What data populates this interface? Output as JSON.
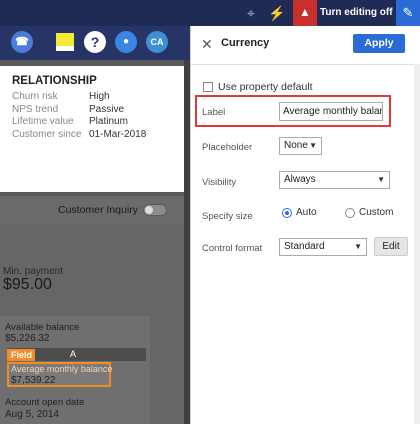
{
  "topbar": {
    "edit_off_label": "Turn editing off"
  },
  "icons": [
    "network-icon",
    "bolt-icon",
    "graduation-cap-icon",
    "pencil-icon",
    "phone-icon",
    "sticky-note-icon",
    "help-icon",
    "bot-icon"
  ],
  "appbar": {
    "avatar_initials": "CA",
    "help_glyph": "?"
  },
  "relationship": {
    "title": "RELATIONSHIP",
    "rows": [
      {
        "label": "Churn risk",
        "value": "High"
      },
      {
        "label": "NPS trend",
        "value": "Passive"
      },
      {
        "label": "Lifetime value",
        "value": "Platinum"
      },
      {
        "label": "Customer since",
        "value": "01-Mar-2018"
      }
    ]
  },
  "left": {
    "customer_inquiry": "Customer Inquiry",
    "min_payment_label": "Min. payment",
    "min_payment_value": "$95.00",
    "available_balance_label": "Available balance",
    "available_balance_value": "$5,226.32",
    "field_tag": "Field",
    "field_column": "A",
    "avg_balance_label": "Average monthly balance",
    "avg_balance_value": "$7,539.22",
    "account_open_label": "Account open date",
    "account_open_value": "Aug 5, 2014"
  },
  "panel": {
    "title": "Currency",
    "apply_label": "Apply",
    "use_property_default": "Use property default",
    "label_label": "Label",
    "label_value": "Average monthly balance",
    "placeholder_label": "Placeholder",
    "placeholder_value": "None",
    "visibility_label": "Visibility",
    "visibility_value": "Always",
    "specify_size_label": "Specify size",
    "size_auto": "Auto",
    "size_custom": "Custom",
    "control_format_label": "Control format",
    "control_format_value": "Standard",
    "edit_label": "Edit"
  },
  "colors": {
    "topbar": "#1f2a55",
    "accent_blue": "#2b6bd8",
    "highlight_red": "#e03a3a",
    "field_orange": "#f28c28"
  }
}
